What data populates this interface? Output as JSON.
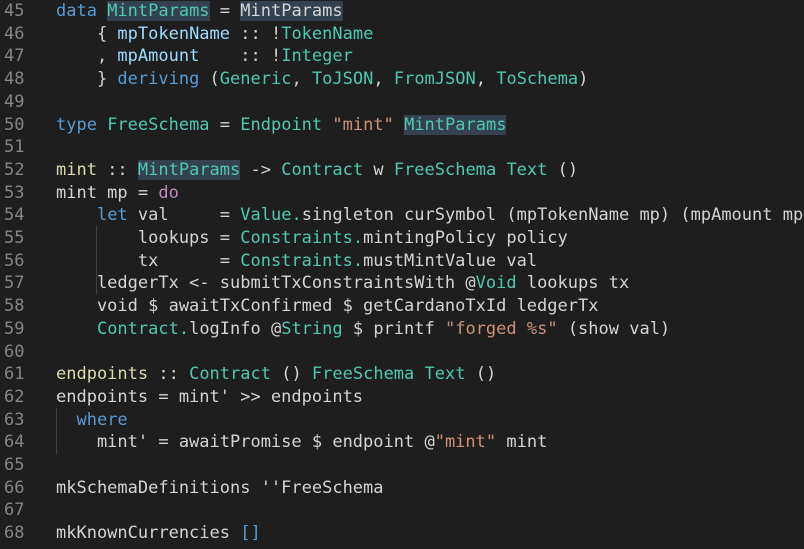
{
  "editor": {
    "lines": [
      {
        "n": "45",
        "tokens": [
          [
            "kw",
            "data "
          ],
          [
            "ty hl",
            "MintParams"
          ],
          [
            "op",
            " = "
          ],
          [
            "op hl",
            "MintParams"
          ]
        ]
      },
      {
        "n": "46",
        "tokens": [
          [
            "op",
            "    { "
          ],
          [
            "var",
            "mpTokenName"
          ],
          [
            "op",
            " :: !"
          ],
          [
            "ty",
            "TokenName"
          ]
        ]
      },
      {
        "n": "47",
        "tokens": [
          [
            "op",
            "    , "
          ],
          [
            "var",
            "mpAmount"
          ],
          [
            "op",
            "    :: !"
          ],
          [
            "ty",
            "Integer"
          ]
        ]
      },
      {
        "n": "48",
        "tokens": [
          [
            "op",
            "    } "
          ],
          [
            "kw",
            "deriving"
          ],
          [
            "op",
            " ("
          ],
          [
            "ty",
            "Generic"
          ],
          [
            "op",
            ", "
          ],
          [
            "ty",
            "ToJSON"
          ],
          [
            "op",
            ", "
          ],
          [
            "ty",
            "FromJSON"
          ],
          [
            "op",
            ", "
          ],
          [
            "ty",
            "ToSchema"
          ],
          [
            "op",
            ")"
          ]
        ]
      },
      {
        "n": "49",
        "tokens": []
      },
      {
        "n": "50",
        "tokens": [
          [
            "kw",
            "type "
          ],
          [
            "ty",
            "FreeSchema"
          ],
          [
            "op",
            " = "
          ],
          [
            "ty",
            "Endpoint"
          ],
          [
            "op",
            " "
          ],
          [
            "str",
            "\"mint\""
          ],
          [
            "op",
            " "
          ],
          [
            "ty hl",
            "MintParams"
          ]
        ]
      },
      {
        "n": "51",
        "tokens": []
      },
      {
        "n": "52",
        "tokens": [
          [
            "fn",
            "mint"
          ],
          [
            "op",
            " :: "
          ],
          [
            "ty hl",
            "MintParams"
          ],
          [
            "op",
            " -> "
          ],
          [
            "ty",
            "Contract"
          ],
          [
            "op",
            " w "
          ],
          [
            "ty",
            "FreeSchema"
          ],
          [
            "op",
            " "
          ],
          [
            "ty",
            "Text"
          ],
          [
            "op",
            " ()"
          ]
        ]
      },
      {
        "n": "53",
        "tokens": [
          [
            "op",
            "mint mp = "
          ],
          [
            "kw2",
            "do"
          ]
        ]
      },
      {
        "n": "54",
        "tokens": [
          [
            "op",
            "    "
          ],
          [
            "kw",
            "let"
          ],
          [
            "op",
            " val     = "
          ],
          [
            "ty",
            "Value."
          ],
          [
            "op",
            "singleton curSymbol (mpTokenName mp) (mpAmount mp)"
          ]
        ]
      },
      {
        "n": "55",
        "tokens": [
          [
            "op",
            "        lookups = "
          ],
          [
            "ty",
            "Constraints."
          ],
          [
            "op",
            "mintingPolicy policy"
          ]
        ]
      },
      {
        "n": "56",
        "tokens": [
          [
            "op",
            "        tx      = "
          ],
          [
            "ty",
            "Constraints."
          ],
          [
            "op",
            "mustMintValue val"
          ]
        ]
      },
      {
        "n": "57",
        "tokens": [
          [
            "op",
            "    ledgerTx <- submitTxConstraintsWith @"
          ],
          [
            "ty",
            "Void"
          ],
          [
            "op",
            " lookups tx"
          ]
        ]
      },
      {
        "n": "58",
        "tokens": [
          [
            "op",
            "    void $ awaitTxConfirmed $ getCardanoTxId ledgerTx"
          ]
        ]
      },
      {
        "n": "59",
        "tokens": [
          [
            "op",
            "    "
          ],
          [
            "ty",
            "Contract."
          ],
          [
            "op",
            "logInfo @"
          ],
          [
            "ty",
            "String"
          ],
          [
            "op",
            " $ printf "
          ],
          [
            "str",
            "\"forged %s\""
          ],
          [
            "op",
            " (show val)"
          ]
        ]
      },
      {
        "n": "60",
        "tokens": []
      },
      {
        "n": "61",
        "tokens": [
          [
            "fn",
            "endpoints"
          ],
          [
            "op",
            " :: "
          ],
          [
            "ty",
            "Contract"
          ],
          [
            "op",
            " () "
          ],
          [
            "ty",
            "FreeSchema"
          ],
          [
            "op",
            " "
          ],
          [
            "ty",
            "Text"
          ],
          [
            "op",
            " ()"
          ]
        ]
      },
      {
        "n": "62",
        "tokens": [
          [
            "op",
            "endpoints = mint' >> endpoints"
          ]
        ]
      },
      {
        "n": "63",
        "tokens": [
          [
            "op",
            "  "
          ],
          [
            "kw",
            "where"
          ]
        ]
      },
      {
        "n": "64",
        "tokens": [
          [
            "op",
            "    mint' = awaitPromise $ endpoint @"
          ],
          [
            "str",
            "\"mint\""
          ],
          [
            "op",
            " mint"
          ]
        ]
      },
      {
        "n": "65",
        "tokens": []
      },
      {
        "n": "66",
        "tokens": [
          [
            "op",
            "mkSchemaDefinitions ''FreeSchema"
          ]
        ]
      },
      {
        "n": "67",
        "tokens": []
      },
      {
        "n": "68",
        "tokens": [
          [
            "op",
            "mkKnownCurrencies "
          ],
          [
            "kw",
            "[]"
          ]
        ]
      }
    ]
  }
}
